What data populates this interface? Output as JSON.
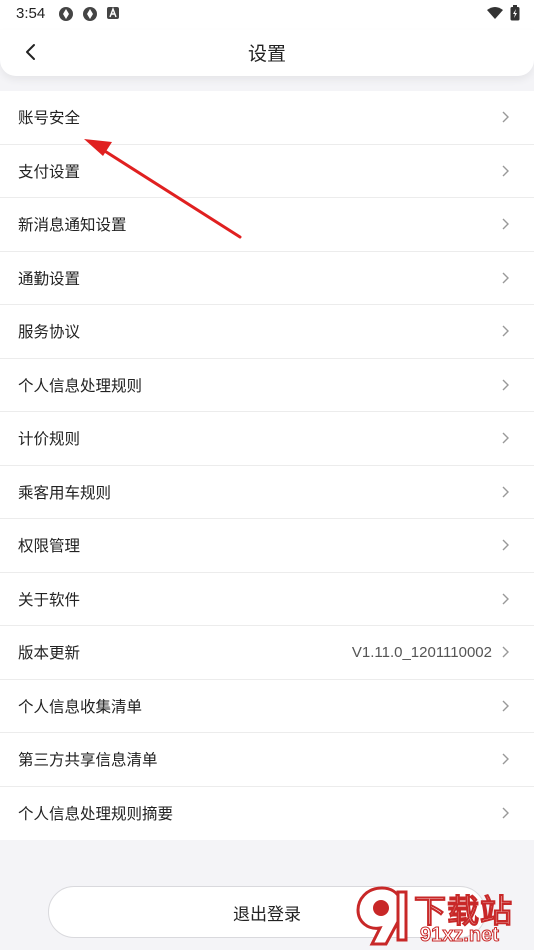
{
  "status_bar": {
    "time": "3:54",
    "left_icons": [
      "app-icon-1",
      "app-icon-2",
      "a-icon"
    ],
    "right_icons": [
      "wifi-icon",
      "battery-icon"
    ]
  },
  "header": {
    "title": "设置",
    "back_icon": "chevron-left-icon"
  },
  "menu": {
    "items": [
      {
        "label": "账号安全",
        "value": ""
      },
      {
        "label": "支付设置",
        "value": ""
      },
      {
        "label": "新消息通知设置",
        "value": ""
      },
      {
        "label": "通勤设置",
        "value": ""
      },
      {
        "label": "服务协议",
        "value": ""
      },
      {
        "label": "个人信息处理规则",
        "value": ""
      },
      {
        "label": "计价规则",
        "value": ""
      },
      {
        "label": "乘客用车规则",
        "value": ""
      },
      {
        "label": "权限管理",
        "value": ""
      },
      {
        "label": "关于软件",
        "value": ""
      },
      {
        "label": "版本更新",
        "value": "V1.11.0_1201110002"
      },
      {
        "label": "个人信息收集清单",
        "value": ""
      },
      {
        "label": "第三方共享信息清单",
        "value": ""
      },
      {
        "label": "个人信息处理规则摘要",
        "value": ""
      }
    ]
  },
  "logout": {
    "label": "退出登录"
  },
  "watermark": {
    "line1": "下载站",
    "line2": "91xz.net"
  },
  "colors": {
    "arrow": "#e02020",
    "background": "#f4f4f7",
    "watermark": "#c82828"
  }
}
